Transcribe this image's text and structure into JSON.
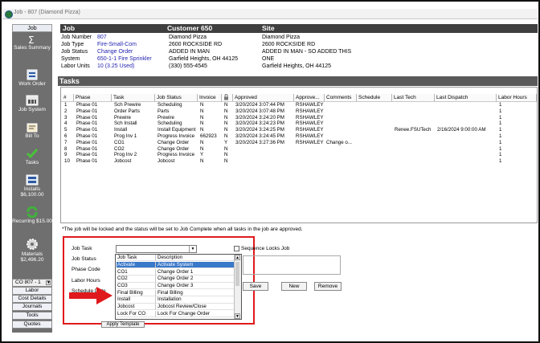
{
  "window": {
    "title": "Job - 807 (Diamond Pizza)"
  },
  "sidebar": {
    "top_tab": "Job",
    "items": [
      {
        "label": "Sales Summary",
        "icon": "sigma-icon"
      },
      {
        "label": "Work Order",
        "icon": "work-order-icon"
      },
      {
        "label": "Job System",
        "icon": "job-system-icon"
      },
      {
        "label": "Bill To",
        "icon": "bill-to-icon"
      },
      {
        "label": "Tasks",
        "icon": "checkmark-icon"
      },
      {
        "label": "Installs $6,100.00",
        "icon": "installs-icon"
      },
      {
        "label": "Recurring $15.00",
        "icon": "recurring-icon"
      },
      {
        "label": "Materials $2,496.20",
        "icon": "materials-gear-icon"
      }
    ],
    "selector": "CO 807 - 1",
    "bottom_tabs": [
      "Labor",
      "Cost Details",
      "Journals",
      "Tools",
      "Quotes"
    ]
  },
  "header": {
    "job": "Job",
    "customer": "Customer 650",
    "site": "Site"
  },
  "job_info": {
    "labels": [
      "Job Number",
      "Job Type",
      "Job Status",
      "System",
      "Labor Units"
    ],
    "values": [
      "807",
      "Fire-Small-Com",
      "Change Order",
      "650-1-1 Fire Sprinkler",
      "10 (3.25 Used)"
    ]
  },
  "customer_info": [
    "Diamond Pizza",
    "2600 ROCKSIDE RD",
    "ADDED IN MAN",
    "Garfield Heights, OH  44125",
    "(330) 555-4545"
  ],
  "site_info": [
    "Diamond Pizza",
    "2600 ROCKSIDE RD",
    "ADDED IN MAN - SO ADDED THIS",
    "ONE",
    "Garfield Heights, OH  44125"
  ],
  "tasks": {
    "title": "Tasks",
    "columns": [
      "#",
      "Phase",
      "Task",
      "Job Status",
      "Invoice",
      "lock-icon",
      "Approved",
      "Approve...",
      "Comments",
      "Schedule",
      "Last Tech",
      "Last Dispatch",
      "Labor Hours"
    ],
    "rows": [
      [
        "1",
        "Phase 01",
        "Sch Prewire",
        "Scheduling",
        "N",
        "N",
        "3/20/2024 3:07:44 PM",
        "RSHAWLEY",
        "",
        "",
        "",
        "",
        "1"
      ],
      [
        "2",
        "Phase 01",
        "Order Parts",
        "Parts",
        "N",
        "N",
        "3/20/2024 3:07:48 PM",
        "RSHAWLEY",
        "",
        "",
        "",
        "",
        "1"
      ],
      [
        "3",
        "Phase 01",
        "Prewire",
        "Prewire",
        "N",
        "N",
        "3/20/2024 3:24:20 PM",
        "RSHAWLEY",
        "",
        "",
        "",
        "",
        "1"
      ],
      [
        "4",
        "Phase 01",
        "Sch Install",
        "Scheduling",
        "N",
        "N",
        "3/20/2024 3:24:23 PM",
        "RSHAWLEY",
        "",
        "",
        "",
        "",
        "1"
      ],
      [
        "5",
        "Phase 01",
        "Install",
        "Install Equipment",
        "N",
        "N",
        "3/20/2024 3:24:25 PM",
        "RSHAWLEY",
        "",
        "",
        "Renee.FSUTech",
        "2/16/2024 9:00:00 AM",
        "1"
      ],
      [
        "6",
        "Phase 01",
        "Prog Inv 1",
        "Progress Invoice",
        "662923",
        "N",
        "3/20/2024 3:24:45 PM",
        "RSHAWLEY",
        "",
        "",
        "",
        "",
        "1"
      ],
      [
        "7",
        "Phase 01",
        "CO1",
        "Change Order",
        "N",
        "Y",
        "3/20/2024 3:27:36 PM",
        "RSHAWLEY",
        "Change o...",
        "",
        "",
        "",
        "1"
      ],
      [
        "8",
        "Phase 01",
        "CO2",
        "Change Order",
        "N",
        "N",
        "",
        "",
        "",
        "",
        "",
        "",
        "1"
      ],
      [
        "9",
        "Phase 01",
        "Prog Inv 2",
        "Progress Invoice",
        "Y",
        "N",
        "",
        "",
        "",
        "",
        "",
        "",
        "1"
      ],
      [
        "10",
        "Phase 01",
        "Jobcost",
        "Jobcost",
        "N",
        "N",
        "",
        "",
        "",
        "",
        "",
        "",
        "1"
      ]
    ],
    "note": "*The job will be locked and the status will be set to Job Complete when all tasks in the job are approved."
  },
  "form": {
    "labels": [
      "Job Task",
      "Job Status",
      "Phase Code",
      "Labor Hours",
      "Schedule Date"
    ],
    "sequence_locks": "Sequence Locks Job",
    "buttons": [
      "Save",
      "New",
      "Remove"
    ],
    "apply_template": "Apply Template",
    "dropdown_columns": [
      "Job Task",
      "Description"
    ],
    "dropdown_rows": [
      [
        "Activate",
        "Activate System"
      ],
      [
        "CO1",
        "Change Order 1"
      ],
      [
        "CO2",
        "Change Order 2"
      ],
      [
        "CO3",
        "Change Order 3"
      ],
      [
        "Final Billing",
        "Final Billing"
      ],
      [
        "Install",
        "Installation"
      ],
      [
        "Jobcost",
        "Jobcost Review/Close"
      ],
      [
        "Lock For CO",
        "Lock For Change Order"
      ]
    ],
    "selected_index": 0
  },
  "colors": {
    "highlight": "#e0191c",
    "selected_row": "#3a78c9",
    "link_text": "#1f1fb0",
    "header_bg": "#3f3f3f"
  }
}
